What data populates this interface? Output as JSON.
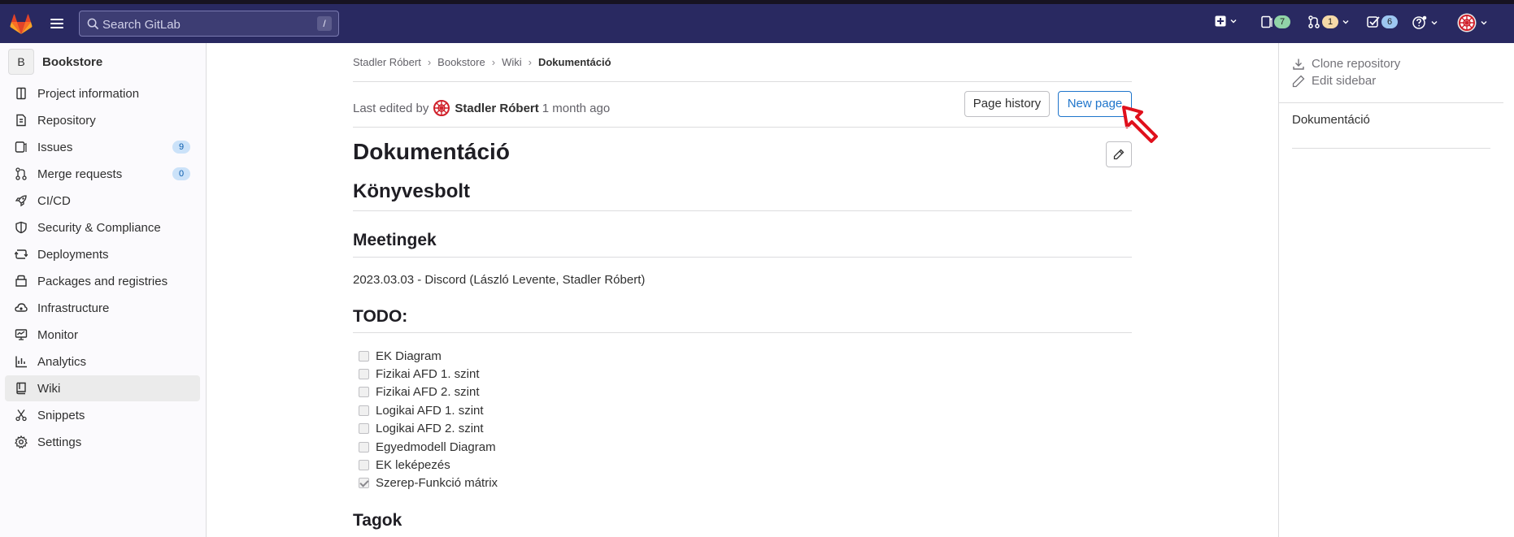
{
  "navbar": {
    "search_placeholder": "Search GitLab",
    "search_shortcut": "/",
    "issues_count": "7",
    "mr_count": "1",
    "todos_count": "6",
    "colors": {
      "bg": "#292961",
      "issues_badge": "#91d4a8",
      "mr_badge": "#f5d9a8",
      "todos_badge": "#9dc7f1"
    }
  },
  "sidebar": {
    "project_initial": "B",
    "project_name": "Bookstore",
    "items": [
      {
        "label": "Project information",
        "icon": "project-icon"
      },
      {
        "label": "Repository",
        "icon": "doc-icon"
      },
      {
        "label": "Issues",
        "icon": "issues-icon",
        "count": "9"
      },
      {
        "label": "Merge requests",
        "icon": "merge-request-icon",
        "count": "0"
      },
      {
        "label": "CI/CD",
        "icon": "rocket-icon"
      },
      {
        "label": "Security & Compliance",
        "icon": "shield-icon"
      },
      {
        "label": "Deployments",
        "icon": "deployments-icon"
      },
      {
        "label": "Packages and registries",
        "icon": "package-icon"
      },
      {
        "label": "Infrastructure",
        "icon": "cloud-icon"
      },
      {
        "label": "Monitor",
        "icon": "monitor-icon"
      },
      {
        "label": "Analytics",
        "icon": "chart-icon"
      },
      {
        "label": "Wiki",
        "icon": "book-icon",
        "active": true
      },
      {
        "label": "Snippets",
        "icon": "snippet-icon"
      },
      {
        "label": "Settings",
        "icon": "settings-icon"
      }
    ]
  },
  "breadcrumb": {
    "items": [
      "Stadler Róbert",
      "Bookstore",
      "Wiki"
    ],
    "current": "Dokumentáció"
  },
  "page": {
    "last_edited_prefix": "Last edited by",
    "author": "Stadler Róbert",
    "time_ago": "1 month ago",
    "history_button": "Page history",
    "new_page_button": "New page",
    "title": "Dokumentáció",
    "h_konyvesbolt": "Könyvesbolt",
    "h_meetingek": "Meetingek",
    "meeting_text": "2023.03.03 - Discord (László Levente, Stadler Róbert)",
    "h_todo": "TODO:",
    "todo_items": [
      {
        "label": "EK Diagram",
        "checked": false
      },
      {
        "label": "Fizikai AFD 1. szint",
        "checked": false
      },
      {
        "label": "Fizikai AFD 2. szint",
        "checked": false
      },
      {
        "label": "Logikai AFD 1. szint",
        "checked": false
      },
      {
        "label": "Logikai AFD 2. szint",
        "checked": false
      },
      {
        "label": "Egyedmodell Diagram",
        "checked": false
      },
      {
        "label": "EK leképezés",
        "checked": false
      },
      {
        "label": "Szerep-Funkció mátrix",
        "checked": true
      }
    ],
    "h_tagok": "Tagok"
  },
  "right_sidebar": {
    "clone": "Clone repository",
    "edit": "Edit sidebar",
    "link": "Dokumentáció"
  }
}
